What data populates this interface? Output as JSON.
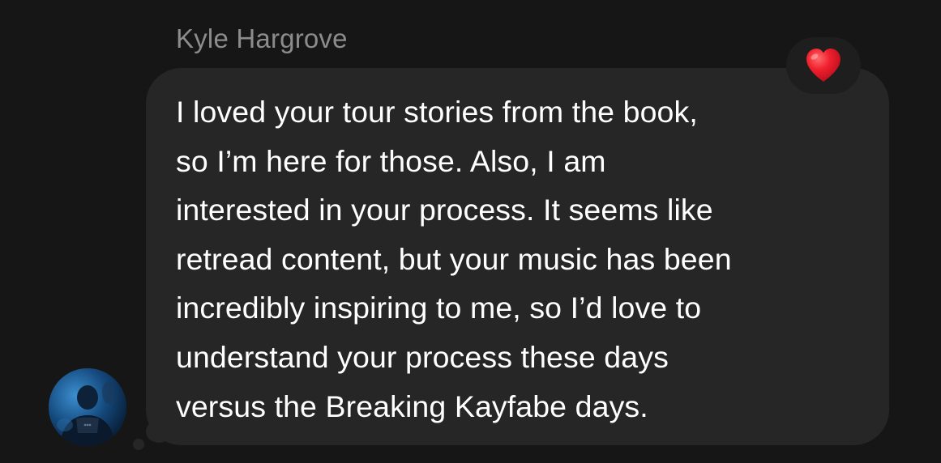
{
  "message": {
    "sender_name": "Kyle Hargrove",
    "text_lines": [
      "I loved your tour stories from the book,",
      "so I’m here for those. Also, I am",
      "interested in your process. It seems like",
      "retread content, but your music has been",
      "incredibly inspiring to me, so I’d love to",
      "understand your process these days",
      "versus the Breaking Kayfabe days."
    ],
    "reaction_icon": "red-heart-icon",
    "avatar_icon": "user-avatar"
  },
  "colors": {
    "background": "#161616",
    "bubble": "#262626",
    "sender_name": "#8c8c8c",
    "text": "#ffffff",
    "heart": "#e8182c"
  }
}
